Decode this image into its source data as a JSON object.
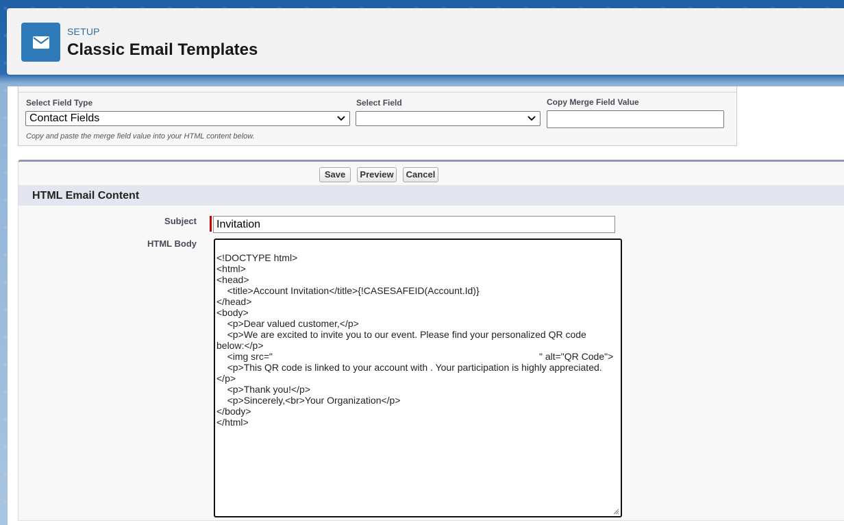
{
  "header": {
    "eyebrow": "SETUP",
    "title": "Classic Email Templates",
    "icon": "email-icon"
  },
  "merge": {
    "field_type_label": "Select Field Type",
    "field_type_value": "Contact Fields",
    "field_label": "Select Field",
    "field_value": "",
    "copy_label": "Copy Merge Field Value",
    "copy_value": "",
    "help_text": "Copy and paste the merge field value into your HTML content below."
  },
  "toolbar": {
    "save": "Save",
    "preview": "Preview",
    "cancel": "Cancel"
  },
  "section": {
    "title": "HTML Email Content"
  },
  "form": {
    "subject_label": "Subject",
    "subject_value": "Invitation",
    "body_label": "HTML Body",
    "body_lines": [
      "<!DOCTYPE html>",
      "<html>",
      "<head>",
      "    <title>Account Invitation</title>{!CASESAFEID(Account.Id)}",
      "</head>",
      "<body>",
      "    <p>Dear valued customer,</p>",
      "    <p>We are excited to invite you to our event. Please find your personalized QR code below:</p>",
      "    <img src=\"                                                                                                    \" alt=\"QR Code\">",
      "    <p>This QR code is linked to your account with . Your participation is highly appreciated.</p>",
      "    <p>Thank you!</p>",
      "    <p>Sincerely,<br>Your Organization</p>",
      "</body>",
      "</html>"
    ]
  }
}
